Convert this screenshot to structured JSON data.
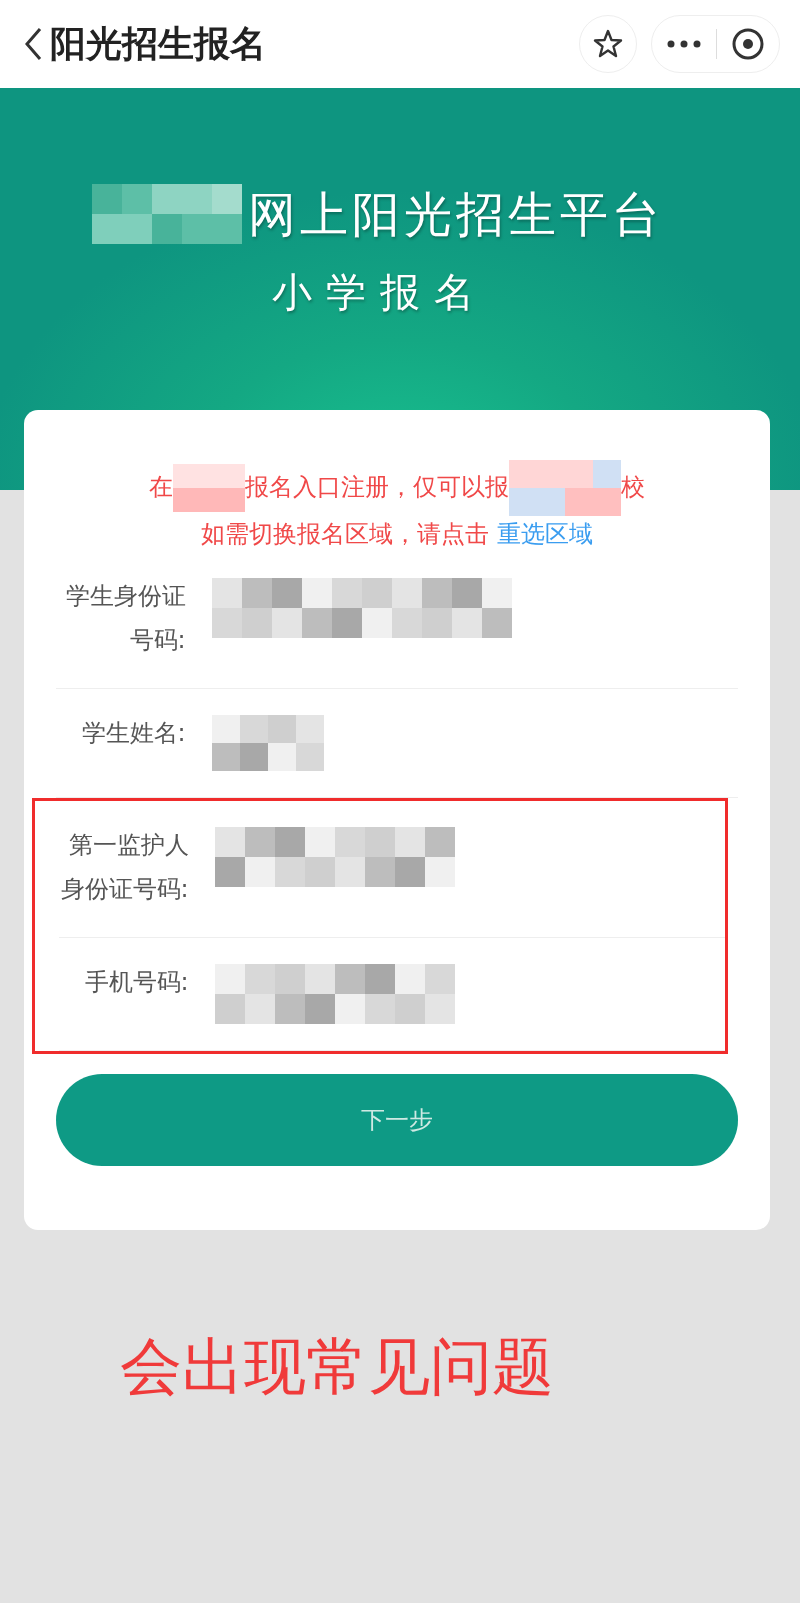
{
  "nav": {
    "title": "阳光招生报名"
  },
  "banner": {
    "title": "网上阳光招生平台",
    "subtitle": "小学报名"
  },
  "notice": {
    "line_1": [
      "在",
      "报名入口注册，仅可以报",
      "校"
    ],
    "line_2": "如需切换报名区域，请点击",
    "link": "重选区域"
  },
  "fields": [
    {
      "label": "学生身份证号码:",
      "highlighted": false
    },
    {
      "label": "学生姓名:",
      "highlighted": false
    },
    {
      "label": "第一监护人身份证号码:",
      "highlighted": true
    },
    {
      "label": "手机号码:",
      "highlighted": true
    }
  ],
  "button": {
    "label": "下一步"
  },
  "annotation": {
    "text": "会出现常见问题"
  }
}
